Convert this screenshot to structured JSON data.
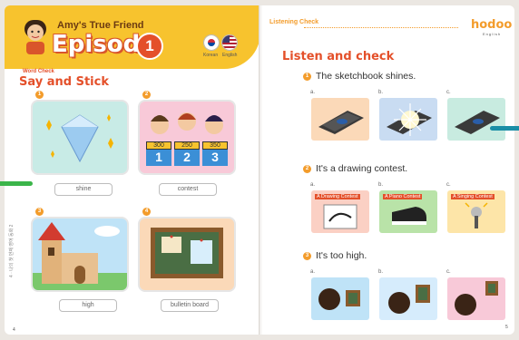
{
  "header": {
    "series_title": "Amy's True Friend",
    "episode_label": "Episode",
    "episode_number": "1",
    "languages": [
      "Korean",
      "English"
    ]
  },
  "say_and_stick": {
    "small_label": "Word Check",
    "title": "Say and Stick",
    "items": [
      {
        "number": "1",
        "word": "shine"
      },
      {
        "number": "2",
        "word": "contest"
      },
      {
        "number": "3",
        "word": "high"
      },
      {
        "number": "4",
        "word": "bulletin board"
      }
    ],
    "contest_scores": [
      "300",
      "250",
      "350"
    ],
    "contest_places": [
      "1",
      "2",
      "3"
    ]
  },
  "listening": {
    "small_label": "Listening Check",
    "logo": "hodoo",
    "logo_sub": "English",
    "title": "Listen and check",
    "option_letters": [
      "a.",
      "b.",
      "c."
    ],
    "questions": [
      {
        "number": "1",
        "text": "The sketchbook shines."
      },
      {
        "number": "2",
        "text": "It's a drawing contest.",
        "contests": [
          "A Drawing Contest",
          "A Piano Contest",
          "A Singing Contest"
        ]
      },
      {
        "number": "3",
        "text": "It's too high."
      }
    ]
  },
  "footer": {
    "left_page_number": "4",
    "right_page_number": "5",
    "side_text": "4 · 나의 첫 번째 영어 동화 2"
  },
  "colors": {
    "accent": "#f39c2b",
    "header": "#f7c32e",
    "title": "#e4502a"
  }
}
